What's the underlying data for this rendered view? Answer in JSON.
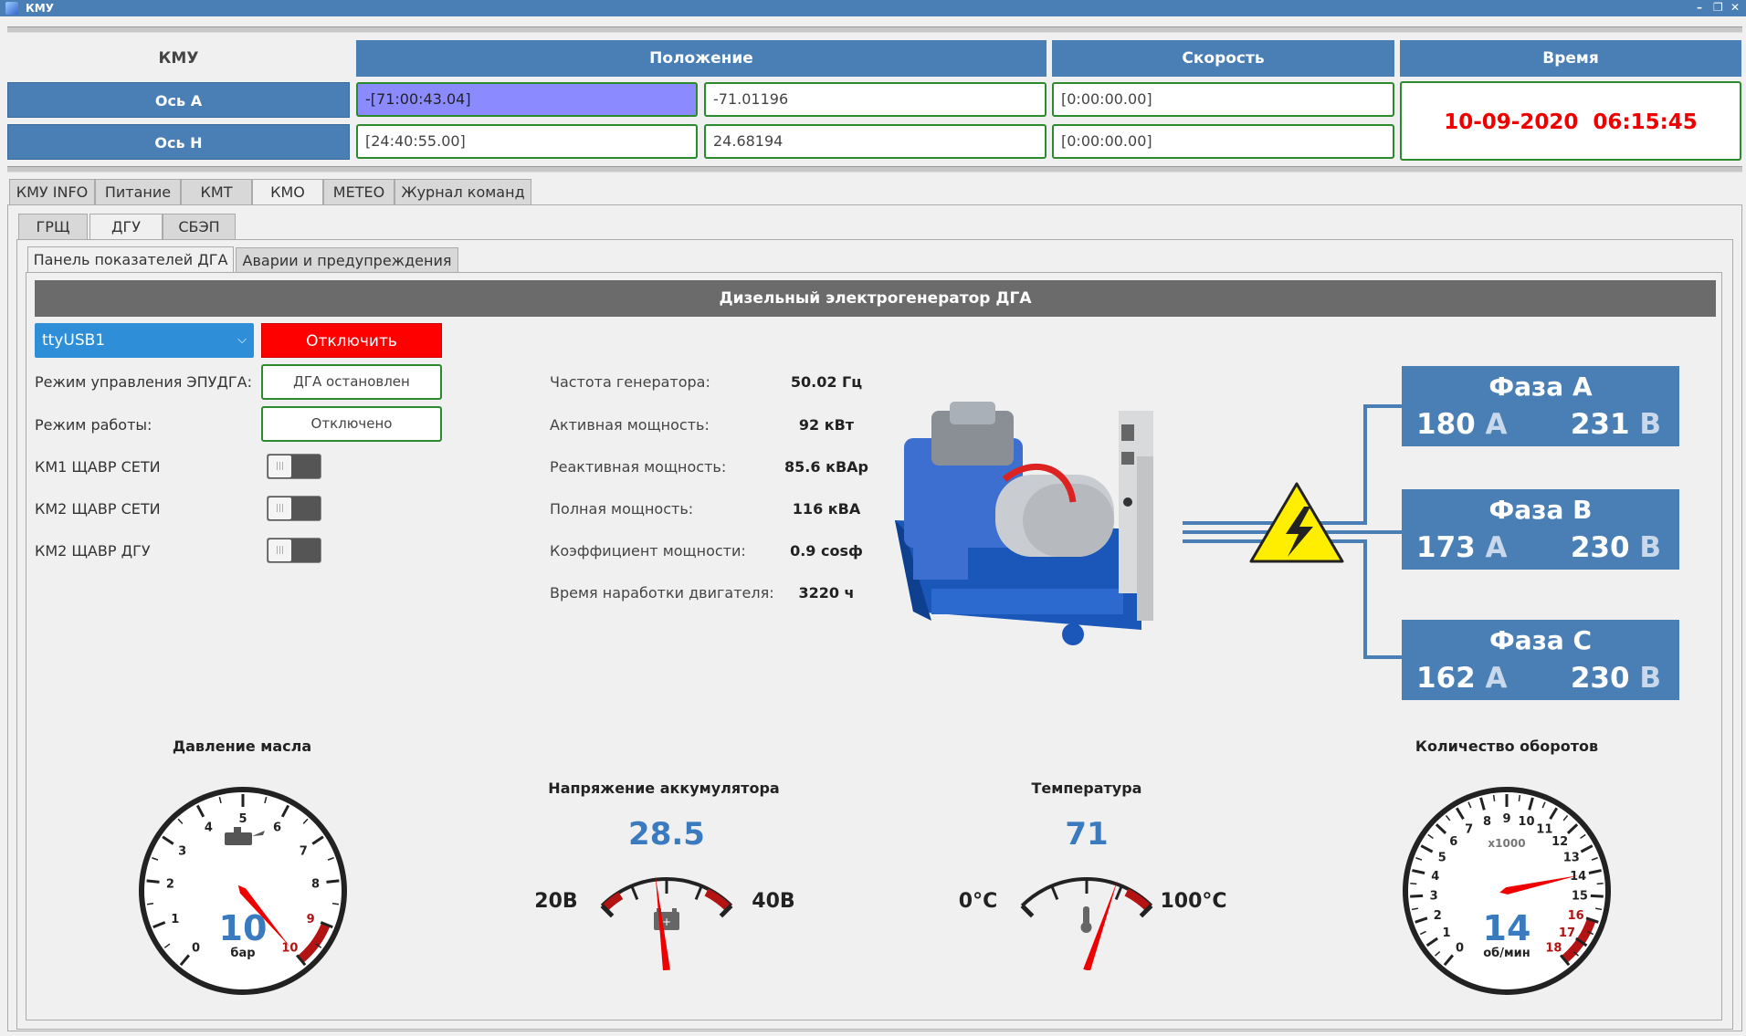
{
  "window": {
    "title": "КМУ"
  },
  "header": {
    "kmu_label": "КМУ",
    "col_position": "Положение",
    "col_speed": "Скорость",
    "col_time": "Время"
  },
  "axes": [
    {
      "label": "Ось А",
      "pos_dms": "-[71:00:43.04]",
      "pos_dec": "-71.01196",
      "speed": "[0:00:00.00]"
    },
    {
      "label": "Ось Н",
      "pos_dms": "[24:40:55.00]",
      "pos_dec": "24.68194",
      "speed": "[0:00:00.00]"
    }
  ],
  "datetime": {
    "date": "10-09-2020",
    "time": "06:15:45"
  },
  "tabs_main": [
    "КМУ INFO",
    "Питание",
    "КМТ",
    "КМО",
    "METEO",
    "Журнал команд"
  ],
  "tabs_sub": [
    "ГРЩ",
    "ДГУ",
    "СБЭП"
  ],
  "tabs_panel": [
    "Панель показателей ДГА",
    "Аварии и предупреждения"
  ],
  "section_title": "Дизельный электрогенератор ДГА",
  "port": {
    "selected": "ttyUSB1"
  },
  "disconnect_label": "Отключить",
  "controls": {
    "mode_epudga_label": "Режим управления ЭПУДГА:",
    "mode_epudga_value": "ДГА остановлен",
    "work_mode_label": "Режим работы:",
    "work_mode_value": "Отключено",
    "km1_label": "КМ1 ЩАВР СЕТИ",
    "km2_net_label": "КМ2 ЩАВР СЕТИ",
    "km2_dgu_label": "КМ2 ЩАВР ДГУ"
  },
  "params": [
    {
      "label": "Частота генератора:",
      "value": "50.02 Гц"
    },
    {
      "label": "Активная мощность:",
      "value": "92 кВт"
    },
    {
      "label": "Реактивная мощность:",
      "value": "85.6 кВАр"
    },
    {
      "label": "Полная мощность:",
      "value": "116 кВА"
    },
    {
      "label": "Коэффициент мощности:",
      "value": "0.9 cosф"
    },
    {
      "label": "Время наработки двигателя:",
      "value": "3220 ч"
    }
  ],
  "phases": [
    {
      "name": "Фаза A",
      "current": "180",
      "voltage": "231",
      "cu": "А",
      "vu": "В"
    },
    {
      "name": "Фаза B",
      "current": "173",
      "voltage": "230",
      "cu": "А",
      "vu": "В"
    },
    {
      "name": "Фаза C",
      "current": "162",
      "voltage": "230",
      "cu": "А",
      "vu": "В"
    }
  ],
  "gauges": {
    "oil": {
      "title": "Давление масла",
      "value": "10",
      "unit": "бар",
      "value_num": 10,
      "max": 10
    },
    "battery": {
      "title": "Напряжение аккумулятора",
      "value": "28.5",
      "min_label": "20В",
      "max_label": "40В",
      "value_num": 28.5,
      "min": 20,
      "max": 40
    },
    "temp": {
      "title": "Температура",
      "value": "71",
      "min_label": "0°C",
      "max_label": "100°C",
      "value_num": 71,
      "min": 0,
      "max": 100
    },
    "rpm": {
      "title": "Количество оборотов",
      "value": "14",
      "unit": "об/мин",
      "scale": "x1000",
      "value_num": 14,
      "max": 18
    }
  },
  "colors": {
    "accent": "#4a7fb5",
    "alarm": "#ff0000",
    "ok_border": "#2b8a2b",
    "value_blue": "#3a7bbf"
  }
}
